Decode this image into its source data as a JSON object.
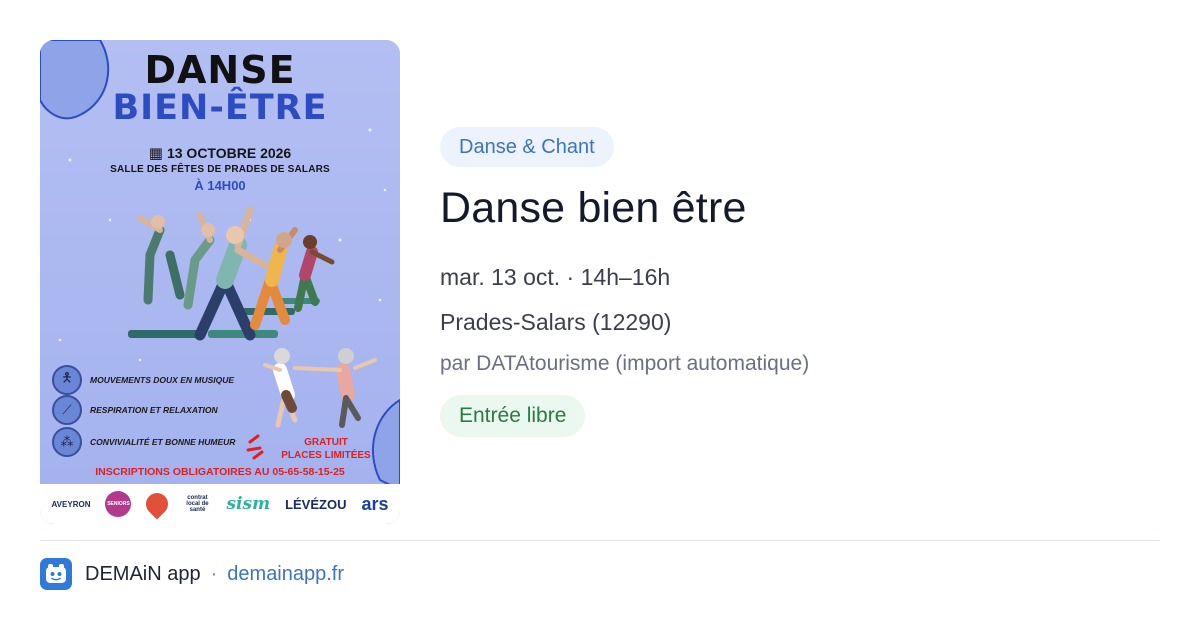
{
  "poster": {
    "title_line1": "DANSE",
    "title_line2": "BIEN-ÊTRE",
    "date": "13 OCTOBRE 2026",
    "venue": "SALLE DES FÊTES DE  PRADES DE SALARS",
    "time": "À 14H00",
    "features": [
      {
        "icon": "person-dancing-icon",
        "label": "MOUVEMENTS DOUX EN MUSIQUE"
      },
      {
        "icon": "breathing-icon",
        "label": "RESPIRATION ET RELAXATION"
      },
      {
        "icon": "group-icon",
        "label": "CONVIVIALITÉ ET BONNE HUMEUR"
      }
    ],
    "free_line1": "GRATUIT",
    "free_line2": "PLACES LIMITÉES",
    "registration": "INSCRIPTIONS OBLIGATOIRES AU 05-65-58-15-25",
    "logos": {
      "aveyron": "AVEYRON",
      "seniors": "SENIORS",
      "contrat": "contrat local de santé",
      "sism": "sism",
      "levezou": "LÉVÉZOU",
      "ars": "ars"
    },
    "colors": {
      "background": "#aab7f0",
      "accent_blue": "#2d4cc2",
      "red": "#e02020"
    }
  },
  "event": {
    "category": "Danse & Chant",
    "title": "Danse bien être",
    "date_time": "mar. 13 oct. · 14h–16h",
    "place": "Prades-Salars (12290)",
    "organizer": "par DATAtourisme (import automatique)",
    "price": "Entrée libre"
  },
  "footer": {
    "app_name": "DEMAiN app",
    "separator": "·",
    "link": "demainapp.fr",
    "app_icon": "demain-app-logo-icon"
  },
  "colors": {
    "category_chip_bg": "#edf3fc",
    "category_chip_text": "#3d73c4",
    "price_chip_bg": "#ebf8ef",
    "price_chip_text": "#2c7a45",
    "link": "#3d73c4"
  }
}
